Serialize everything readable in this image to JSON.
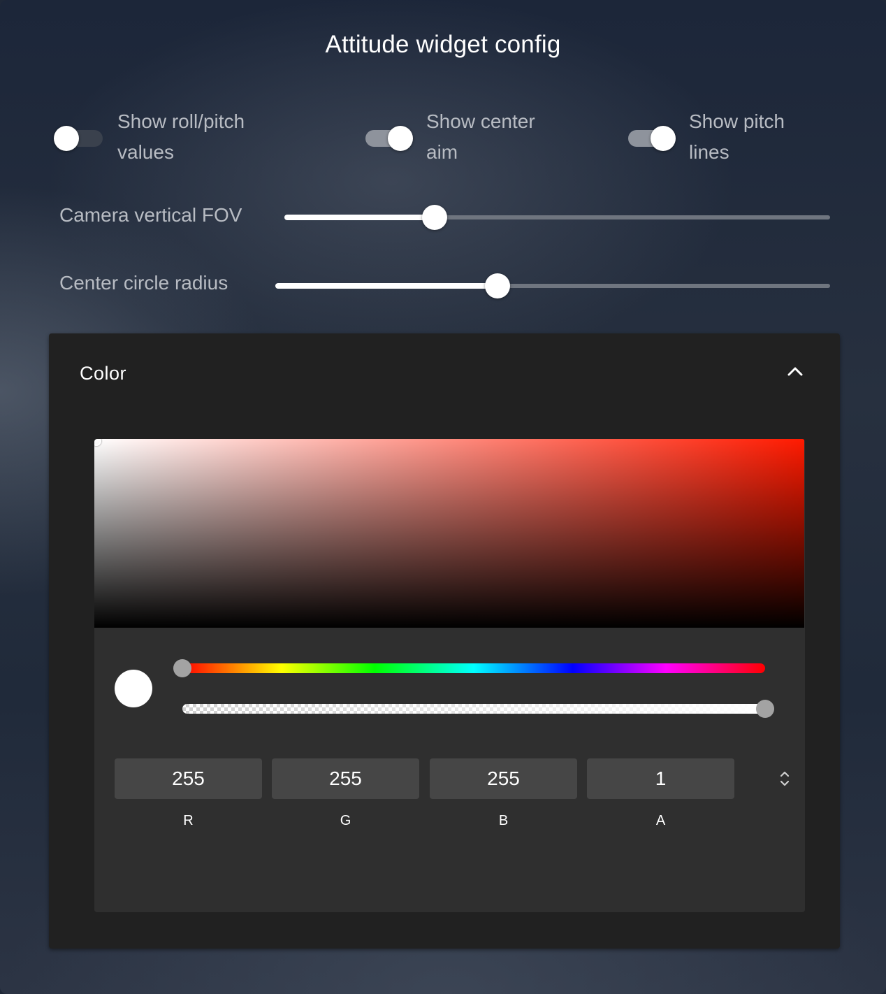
{
  "title": "Attitude widget config",
  "toggles": [
    {
      "label": "Show roll/pitch values",
      "state": "off"
    },
    {
      "label": "Show center aim",
      "state": "on"
    },
    {
      "label": "Show pitch lines",
      "state": "on"
    }
  ],
  "sliders": [
    {
      "label": "Camera vertical FOV",
      "value_fraction": 0.275
    },
    {
      "label": "Center circle radius",
      "value_fraction": 0.4
    }
  ],
  "color_section": {
    "title": "Color",
    "expanded": true,
    "collapse_icon": "chevron-up-icon",
    "current_color": "#ffffff",
    "hue_fraction": 0.0,
    "alpha_fraction": 1.0,
    "fields": [
      {
        "label": "R",
        "value": "255"
      },
      {
        "label": "G",
        "value": "255"
      },
      {
        "label": "B",
        "value": "255"
      },
      {
        "label": "A",
        "value": "1"
      }
    ],
    "mode_toggle_icon": "unfold-more-icon",
    "swatches": [
      {
        "color": "#ffffff",
        "selected": true,
        "icon": "check-circle-icon"
      },
      {
        "color": "#f44336",
        "selected": false
      },
      {
        "color": "#4caf50",
        "selected": false,
        "transparent": true
      }
    ]
  }
}
